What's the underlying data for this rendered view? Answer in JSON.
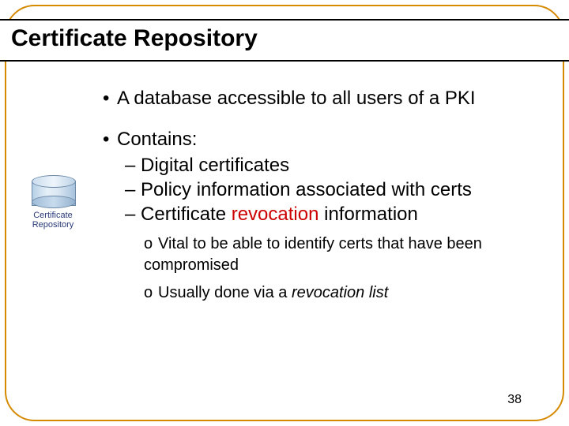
{
  "title": "Certificate Repository",
  "icon": {
    "label_line1": "Certificate",
    "label_line2": "Repository"
  },
  "bullets": {
    "b1": "A database accessible to all users of a PKI",
    "b2": "Contains:",
    "d1": "Digital certificates",
    "d2": "Policy information associated with certs",
    "d3_pre": "Certificate ",
    "d3_red": "revocation",
    "d3_post": " information",
    "o1": "Vital to be able to identify certs that have been compromised",
    "o2_pre": "Usually done via a ",
    "o2_em": "revocation list"
  },
  "page_number": "38"
}
